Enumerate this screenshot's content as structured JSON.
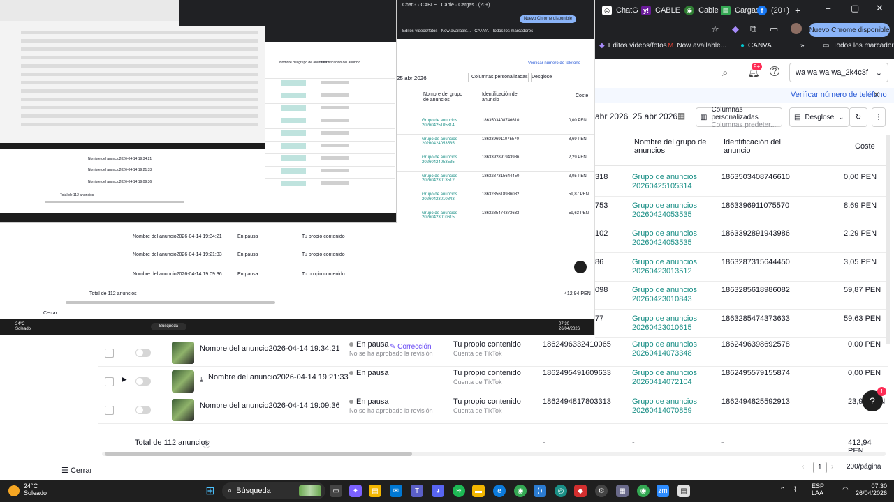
{
  "browser": {
    "tabs": [
      "ChatG",
      "CABLE",
      "Cable",
      "Cargas",
      "(20+)"
    ],
    "new_tab": "+",
    "window_controls": [
      "–",
      "▢",
      "✕"
    ],
    "chrome_update": "Nuevo Chrome disponible",
    "bookmarks": [
      "Editos videos/fotos",
      "Now available...",
      "CANVA",
      "Todos los marcadores"
    ]
  },
  "header": {
    "account": "wa wa wa wa_2k4c3f",
    "notif_count": "9+"
  },
  "verify": {
    "text": "Verificar número de teléfono"
  },
  "filters": {
    "date": "25 abr 2026",
    "columns_label": "Columnas personalizadas",
    "columns_sub": "Columnas predeter...",
    "breakdown": "Desglose"
  },
  "table": {
    "columns": {
      "group": "Nombre del grupo de anuncios",
      "id": "Identificación del anuncio",
      "cost": "Coste"
    },
    "rows": [
      {
        "left": "318",
        "group": "Grupo de anuncios 20260425105314",
        "id": "1863503408746610",
        "cost": "0,00 PEN"
      },
      {
        "left": "753",
        "group": "Grupo de anuncios 20260424053535",
        "id": "1863396911075570",
        "cost": "8,69 PEN"
      },
      {
        "left": "102",
        "group": "Grupo de anuncios 20260424053535",
        "id": "1863392891943986",
        "cost": "2,29 PEN"
      },
      {
        "left": "86",
        "group": "Grupo de anuncios 20260423013512",
        "id": "1863287315644450",
        "cost": "3,05 PEN"
      },
      {
        "left": "098",
        "group": "Grupo de anuncios 20260423010843",
        "id": "1863285618986082",
        "cost": "59,87 PEN"
      },
      {
        "left": "77",
        "group": "Grupo de anuncios 20260423010615",
        "id": "1863285474373633",
        "cost": "59,63 PEN"
      }
    ],
    "bottom_rows": [
      {
        "name": "Nombre del anuncio2026-04-14 19:34:21",
        "status": "En pausa",
        "badge": "Corrección",
        "status_sub": "No se ha aprobado la revisión",
        "identity": "Tu propio contenido",
        "identity_sub": "Cuenta de TikTok",
        "ad_id": "1862496332410065",
        "group": "Grupo de anuncios 20260414073348",
        "id": "1862496398692578",
        "cost": "0,00 PEN"
      },
      {
        "name": "Nombre del anuncio2026-04-14 19:21:33",
        "status": "En pausa",
        "badge": "",
        "status_sub": "",
        "identity": "Tu propio contenido",
        "identity_sub": "Cuenta de TikTok",
        "ad_id": "1862495491609633",
        "group": "Grupo de anuncios 20260414072104",
        "id": "1862495579155874",
        "cost": "0,00 PEN"
      },
      {
        "name": "Nombre del anuncio2026-04-14 19:09:36",
        "status": "En pausa",
        "badge": "",
        "status_sub": "No se ha aprobado la revisión",
        "identity": "Tu propio contenido",
        "identity_sub": "Cuenta de TikTok",
        "ad_id": "1862494817803313",
        "group": "Grupo de anuncios 20260414070859",
        "id": "1862494825592913",
        "cost": "23,96 PEN"
      }
    ],
    "total_label": "Total de 112 anuncios",
    "total_dash": "-",
    "total_cost": "412,94 PEN",
    "page": "1",
    "per_page": "200/página",
    "close": "Cerrar"
  },
  "help": {
    "badge": "1"
  },
  "taskbar": {
    "weather_temp": "24°C",
    "weather_text": "Soleado",
    "search": "Búsqueda",
    "lang1": "ESP",
    "lang2": "LAA",
    "time": "07:30",
    "date": "26/04/2026"
  },
  "nested": {
    "taskbar_search": "Búsqueda",
    "temp": "24°C",
    "weather": "Soleado"
  }
}
